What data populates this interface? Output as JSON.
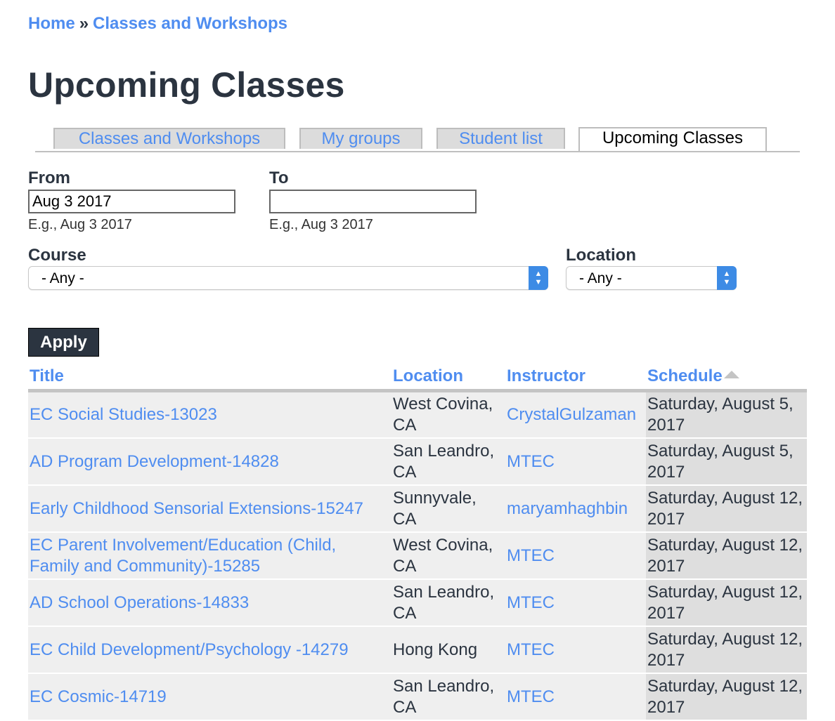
{
  "breadcrumb": {
    "home": "Home",
    "separator": "»",
    "current": "Classes and Workshops"
  },
  "page_title": "Upcoming Classes",
  "tabs": [
    {
      "label": "Classes and Workshops",
      "active": false
    },
    {
      "label": "My groups",
      "active": false
    },
    {
      "label": "Student list",
      "active": false
    },
    {
      "label": "Upcoming Classes",
      "active": true
    }
  ],
  "filters": {
    "from": {
      "label": "From",
      "value": "Aug 3 2017",
      "hint": "E.g., Aug 3 2017"
    },
    "to": {
      "label": "To",
      "value": "",
      "hint": "E.g., Aug 3 2017"
    },
    "course": {
      "label": "Course",
      "selected": "- Any -"
    },
    "location": {
      "label": "Location",
      "selected": "- Any -"
    },
    "apply_label": "Apply"
  },
  "table": {
    "headers": {
      "title": "Title",
      "location": "Location",
      "instructor": "Instructor",
      "schedule": "Schedule"
    },
    "sort_column": "schedule",
    "rows": [
      {
        "title": "EC Social Studies-13023",
        "location": "West Covina, CA",
        "instructor": "CrystalGulzaman",
        "schedule": "Saturday, August 5, 2017"
      },
      {
        "title": "AD Program Development-14828",
        "location": "San Leandro, CA",
        "instructor": "MTEC",
        "schedule": "Saturday, August 5, 2017"
      },
      {
        "title": "Early Childhood Sensorial Extensions-15247",
        "location": "Sunnyvale, CA",
        "instructor": "maryamhaghbin",
        "schedule": "Saturday, August 12, 2017"
      },
      {
        "title": "EC Parent Involvement/Education (Child, Family and Community)-15285",
        "location": "West Covina, CA",
        "instructor": "MTEC",
        "schedule": "Saturday, August 12, 2017"
      },
      {
        "title": "AD School Operations-14833",
        "location": "San Leandro, CA",
        "instructor": "MTEC",
        "schedule": "Saturday, August 12, 2017"
      },
      {
        "title": "EC Child Development/Psychology -14279",
        "location": "Hong Kong",
        "instructor": "MTEC",
        "schedule": "Saturday, August 12, 2017"
      },
      {
        "title": "EC Cosmic-14719",
        "location": "San Leandro, CA",
        "instructor": "MTEC",
        "schedule": "Saturday, August 12, 2017"
      }
    ]
  },
  "colors": {
    "link": "#4f8df0",
    "heading": "#2b3440",
    "select_accent": "#3d8be5"
  }
}
